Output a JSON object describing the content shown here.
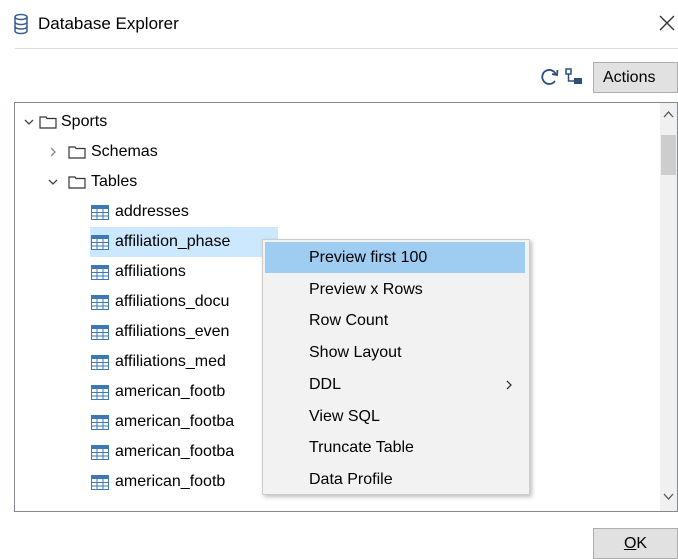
{
  "window": {
    "title": "Database Explorer",
    "icon": "database-icon",
    "close_icon": "close-icon"
  },
  "toolbar": {
    "refresh_icon": "refresh-icon",
    "tree_icon": "tree-structure-icon",
    "actions_label": "Actions"
  },
  "tree": {
    "root": {
      "label": "Sports",
      "expanded": true
    },
    "schemas": {
      "label": "Schemas",
      "expanded": false
    },
    "tables_folder": {
      "label": "Tables",
      "expanded": true
    },
    "tables": [
      "addresses",
      "affiliation_phase",
      "affiliations",
      "affiliations_docu",
      "affiliations_even",
      "affiliations_med",
      "american_footb",
      "american_footba",
      "american_footba",
      "american_footb"
    ],
    "selected_index": 1
  },
  "context_menu": {
    "items": [
      "Preview first 100",
      "Preview x Rows",
      "Row Count",
      "Show Layout",
      "DDL",
      "View SQL",
      "Truncate Table",
      "Data Profile"
    ],
    "highlighted_index": 0,
    "submenu_index": 4
  },
  "footer": {
    "ok_label_mnemonic": "O",
    "ok_label_rest": "K"
  },
  "colors": {
    "selection": "#cce8ff",
    "menu_highlight": "#9fcdf1",
    "button_bg": "#e1e1e1",
    "table_icon": "#3c78b4"
  }
}
